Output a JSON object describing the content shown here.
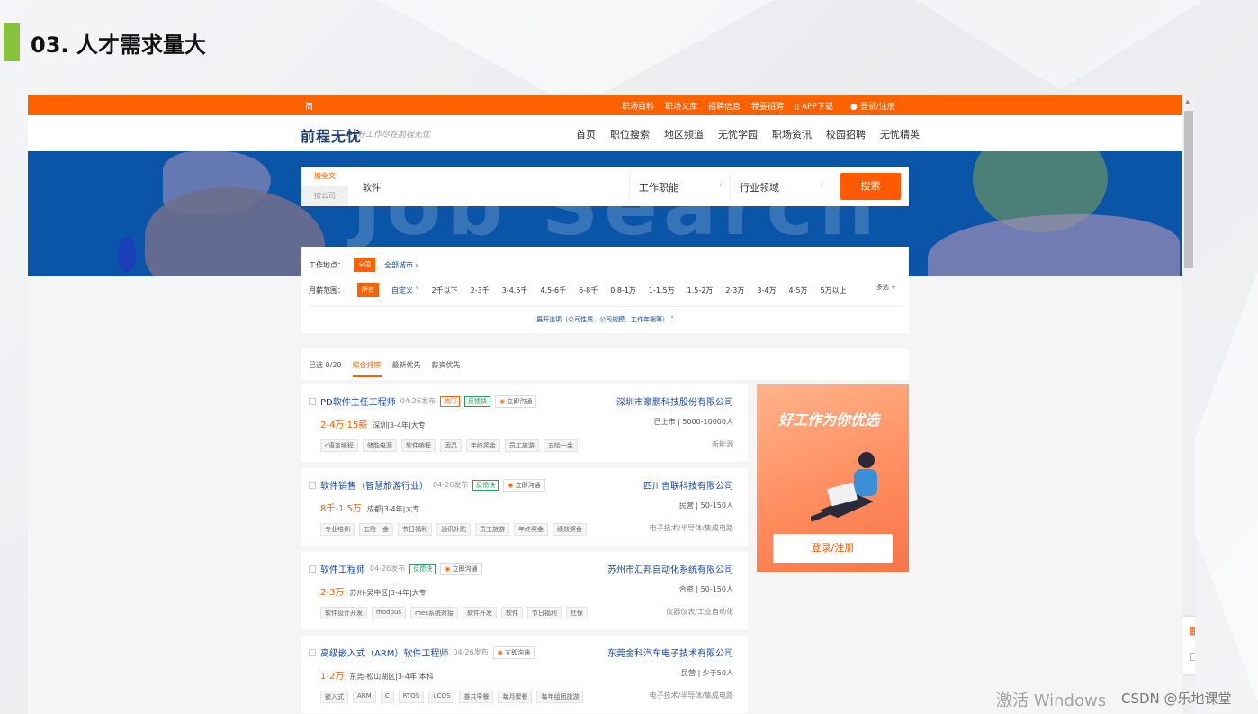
{
  "slide": {
    "title": "03. 人才需求量大"
  },
  "site": {
    "topbar": {
      "lang": "简",
      "links": [
        "职场百科",
        "职场文库",
        "招聘信息",
        "我要招聘",
        "APP下载"
      ],
      "login": "登录/注册"
    },
    "logo": "前程无忧",
    "slogan": "好工作尽在前程无忧",
    "nav": [
      "首页",
      "职位搜索",
      "地区频道",
      "无忧学园",
      "职场资讯",
      "校园招聘",
      "无忧精英"
    ],
    "banner_watermark": "Job Search",
    "search": {
      "tab_fulltext": "搜全文",
      "tab_company": "搜公司",
      "keyword": "软件",
      "job_function": "工作职能",
      "industry": "行业领域",
      "button": "搜索"
    },
    "filter": {
      "location_label": "工作地点：",
      "location_selected": "全国",
      "all_cities": "全部城市 ›",
      "salary_label": "月薪范围：",
      "salary_selected": "所有",
      "custom": "自定义 ˅",
      "ranges": [
        "2千以下",
        "2-3千",
        "3-4.5千",
        "4.5-6千",
        "6-8千",
        "0.8-1万",
        "1-1.5万",
        "1.5-2万",
        "2-3万",
        "3-4万",
        "4-5万",
        "5万以上"
      ],
      "multi": "多选 +",
      "expand": "展开选项（公司性质、公司规模、工作年限等） ˅"
    },
    "sort": {
      "selected_count": "已选 0/20",
      "options": [
        "综合排序",
        "最新优先",
        "薪资优先"
      ]
    },
    "jobs": [
      {
        "title": "PD软件主任工程师",
        "date": "04-26发布",
        "badges": [
          "热门",
          "反馈快"
        ],
        "chat": "立即沟通",
        "salary": "2-4万·15薪",
        "meta": "深圳|3-4年|大专",
        "tags": [
          "c语言编程",
          "储能电源",
          "软件编程",
          "团灵",
          "年终奖金",
          "员工旅游",
          "五险一金"
        ],
        "company": "深圳市豪鹏科技股份有限公司",
        "company_info": "已上市 | 5000-10000人",
        "industry": "新能源"
      },
      {
        "title": "软件销售（智慧旅游行业）",
        "date": "04-26发布",
        "badges": [
          "反馈快"
        ],
        "chat": "立即沟通",
        "salary": "8千-1.5万",
        "meta": "成都|3-4年|大专",
        "tags": [
          "专业培训",
          "五险一金",
          "节日福利",
          "通讯补贴",
          "员工旅游",
          "年终奖金",
          "绩效奖金"
        ],
        "company": "四川吉联科技有限公司",
        "company_info": "民营 | 50-150人",
        "industry": "电子技术/半导体/集成电路"
      },
      {
        "title": "软件工程师",
        "date": "04-26发布",
        "badges": [
          "反馈快"
        ],
        "chat": "立即沟通",
        "salary": "2-3万",
        "meta": "苏州-吴中区|3-4年|大专",
        "tags": [
          "软件设计开发",
          "modbus",
          "mes系统对接",
          "软件开发",
          "软件",
          "节日福利",
          "社保"
        ],
        "company": "苏州市汇邦自动化系统有限公司",
        "company_info": "合资 | 50-150人",
        "industry": "仪器仪表/工业自动化"
      },
      {
        "title": "高级嵌入式（ARM）软件工程师",
        "date": "04-26发布",
        "badges": [],
        "chat": "立即沟通",
        "salary": "1-2万",
        "meta": "东莞-松山湖区|3-4年|本科",
        "tags": [
          "嵌入式",
          "ARM",
          "C",
          "RTOS",
          "uCOS",
          "普共早餐",
          "每月聚餐",
          "每年组团旅游"
        ],
        "company": "东莞金科汽车电子技术有限公司",
        "company_info": "民营 | 少于50人",
        "industry": "电子技术/半导体/集成电路"
      }
    ],
    "ad": {
      "headline": "好工作为你优选",
      "button": "登录/注册"
    }
  },
  "watermarks": {
    "windows": "激活 Windows",
    "csdn": "CSDN @乐地课堂"
  }
}
